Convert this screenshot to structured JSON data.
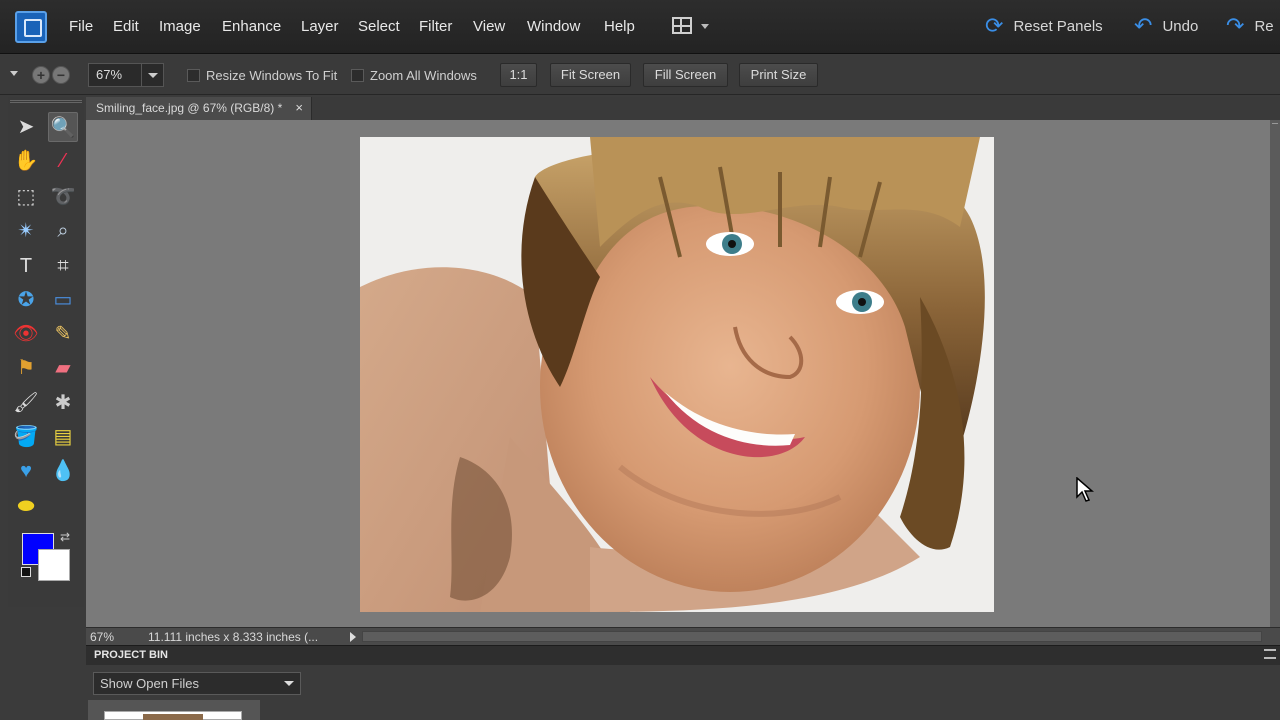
{
  "menubar": {
    "items": [
      "File",
      "Edit",
      "Image",
      "Enhance",
      "Layer",
      "Select",
      "Filter",
      "View",
      "Window",
      "Help"
    ],
    "reset_panels": "Reset Panels",
    "undo": "Undo",
    "redo": "Re"
  },
  "options": {
    "zoom_value": "67%",
    "resize_windows": "Resize Windows To Fit",
    "zoom_all_windows": "Zoom All Windows",
    "btn_1to1": "1:1",
    "btn_fit_screen": "Fit Screen",
    "btn_fill_screen": "Fill Screen",
    "btn_print_size": "Print Size"
  },
  "document": {
    "tab_title": "Smiling_face.jpg @ 67% (RGB/8) *",
    "close": "×"
  },
  "status": {
    "zoom": "67%",
    "dimensions": "11.111 inches x 8.333 inches (..."
  },
  "project_bin": {
    "title": "PROJECT BIN",
    "show_option": "Show Open Files"
  },
  "colors": {
    "foreground": "#0000ff",
    "background": "#ffffff",
    "accent": "#3a8ee6"
  }
}
